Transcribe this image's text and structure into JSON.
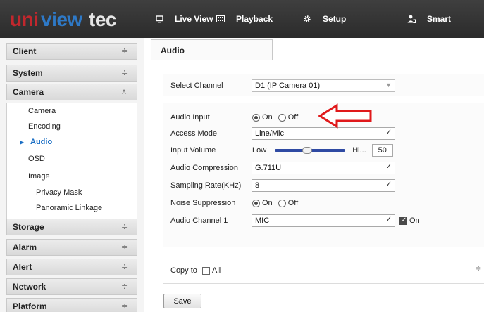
{
  "app": {
    "logo_text": "uniview tec",
    "nav": [
      {
        "label": "Live View",
        "icon": "monitor-icon"
      },
      {
        "label": "Playback",
        "icon": "film-icon"
      },
      {
        "label": "Setup",
        "icon": "gear-icon"
      },
      {
        "label": "Smart",
        "icon": "person-icon"
      }
    ]
  },
  "sidebar": {
    "groups": [
      {
        "label": "Client",
        "expanded": false
      },
      {
        "label": "System",
        "expanded": false
      },
      {
        "label": "Camera",
        "expanded": true
      },
      {
        "label": "Storage",
        "expanded": false
      },
      {
        "label": "Alarm",
        "expanded": false
      },
      {
        "label": "Alert",
        "expanded": false
      },
      {
        "label": "Network",
        "expanded": false
      },
      {
        "label": "Platform",
        "expanded": false
      }
    ],
    "camera_items": [
      "Camera",
      "Encoding",
      "Audio",
      "OSD",
      "Image",
      "Privacy Mask",
      "Panoramic Linkage"
    ],
    "active_item": "Audio"
  },
  "main": {
    "tab": "Audio",
    "select_channel": {
      "label": "Select Channel",
      "value": "D1 (IP Camera 01)"
    },
    "audio_input": {
      "label": "Audio Input",
      "on_label": "On",
      "off_label": "Off",
      "selected": "On"
    },
    "access_mode": {
      "label": "Access Mode",
      "value": "Line/Mic"
    },
    "input_volume": {
      "label": "Input Volume",
      "low_label": "Low",
      "high_label": "Hi...",
      "value": "50",
      "level": 0.45
    },
    "audio_compression": {
      "label": "Audio Compression",
      "value": "G.711U"
    },
    "sampling_rate": {
      "label": "Sampling Rate(KHz)",
      "value": "8"
    },
    "noise_suppression": {
      "label": "Noise Suppression",
      "on_label": "On",
      "off_label": "Off",
      "selected": "On"
    },
    "audio_channel_1": {
      "label": "Audio Channel 1",
      "value": "MIC",
      "enable_label": "On",
      "enabled": true
    },
    "copy_to": {
      "label": "Copy to",
      "all_label": "All"
    },
    "save_label": "Save"
  },
  "colors": {
    "topbar": "#333333",
    "accent_blue": "#1a6ec4",
    "slider_track": "#2f4aa3",
    "annotation_arrow": "#e0191b"
  }
}
